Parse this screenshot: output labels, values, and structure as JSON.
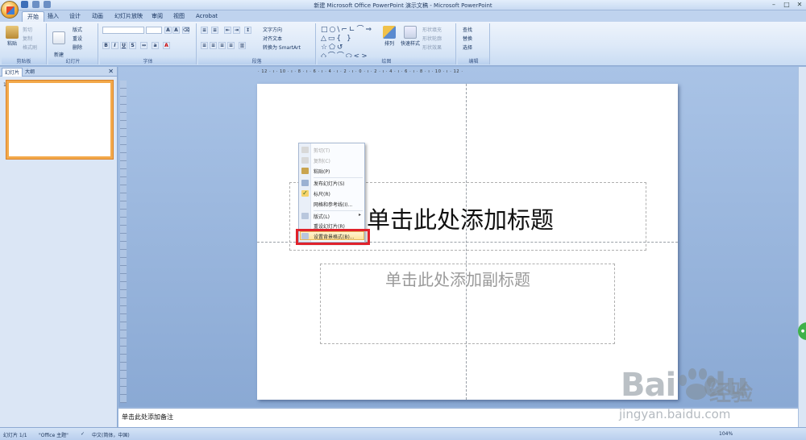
{
  "window": {
    "title": "新建 Microsoft Office PowerPoint 演示文稿 - Microsoft PowerPoint",
    "min": "–",
    "max": "□",
    "close": "✕"
  },
  "tabs": [
    "开始",
    "插入",
    "设计",
    "动画",
    "幻灯片放映",
    "审阅",
    "视图",
    "Acrobat"
  ],
  "ribbon": {
    "clipboard": {
      "paste": "粘贴",
      "cut": "剪切",
      "copy": "复制",
      "format_painter": "格式刷",
      "label": "剪贴板"
    },
    "slides": {
      "new_slide": "新建\n幻灯片",
      "layout": "版式",
      "reset": "重设",
      "delete": "删除",
      "label": "幻灯片"
    },
    "font": {
      "label": "字体"
    },
    "paragraph": {
      "text_direction": "文字方向",
      "align_text": "对齐文本",
      "smartart": "转换为 SmartArt",
      "label": "段落"
    },
    "drawing": {
      "arrange": "排列",
      "quick_styles": "快速样式",
      "shape_fill": "形状填充",
      "shape_outline": "形状轮廓",
      "shape_effects": "形状效果",
      "label": "绘图"
    },
    "editing": {
      "find": "查找",
      "replace": "替换",
      "select": "选择",
      "label": "编辑"
    }
  },
  "left_pane": {
    "tab_slides": "幻灯片",
    "tab_outline": "大纲",
    "close": "✕",
    "thumb_number": "1"
  },
  "ruler_text": "· 12 · ı · 10 · ı · 8 · ı · 6 · ı · 4 · ı · 2 · ı · 0 · ı · 2 · ı · 4 · ı · 6 · ı · 8 · ı · 10 · ı · 12 ·",
  "slide": {
    "title_placeholder": "单击此处添加标题",
    "subtitle_placeholder": "单击此处添加副标题"
  },
  "context_menu": {
    "items": [
      {
        "label": "剪切(T)",
        "enabled": false
      },
      {
        "label": "复制(C)",
        "enabled": false
      },
      {
        "label": "粘贴(P)",
        "enabled": true
      },
      {
        "label": "发布幻灯片(S)",
        "enabled": true
      },
      {
        "label": "标尺(R)",
        "enabled": true
      },
      {
        "label": "网格和参考线(I)...",
        "enabled": true
      },
      {
        "label": "版式(L)",
        "enabled": true
      },
      {
        "label": "重设幻灯片(R)",
        "enabled": true
      },
      {
        "label": "设置背景格式(B)...",
        "enabled": true,
        "highlighted": true
      }
    ]
  },
  "notes": {
    "placeholder": "单击此处添加备注"
  },
  "status_bar": {
    "slide_count": "幻灯片 1/1",
    "theme": "\"Office 主题\"",
    "language": "中文(简体，中国)",
    "zoom": "104%"
  },
  "watermark": {
    "brand": "Bai",
    "brand2": "du",
    "cn": "经验",
    "url": "jingyan.baidu.com"
  },
  "colors": {
    "accent": "#f3a94a",
    "highlight_box": "#e0222b",
    "ribbon": "#dde9f8",
    "canvas": "#9bb8de"
  }
}
